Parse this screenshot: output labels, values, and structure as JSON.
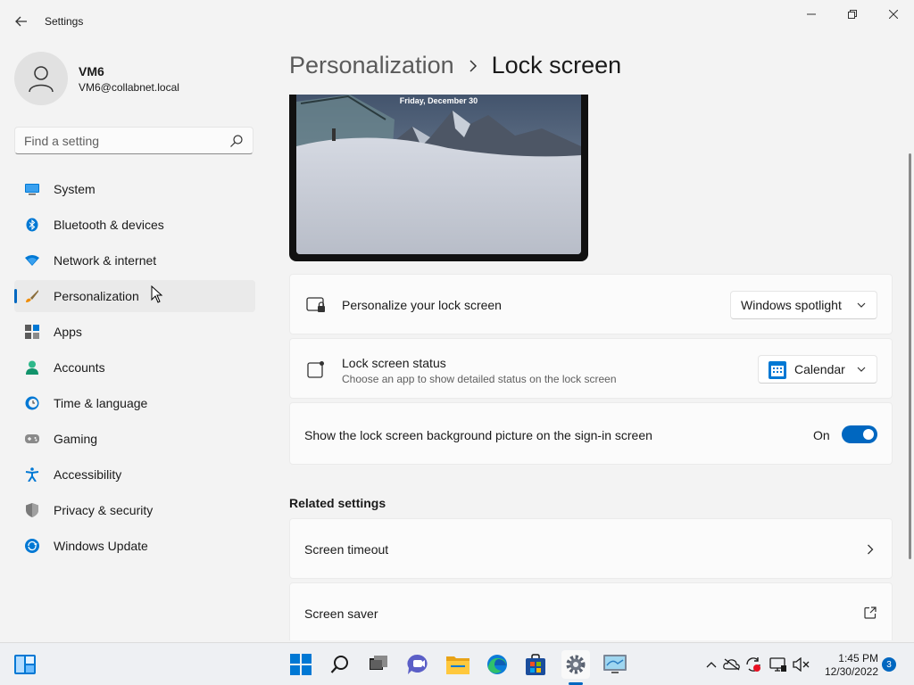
{
  "window": {
    "title": "Settings",
    "back_icon": "arrow-left-icon",
    "controls": [
      "minimize-icon",
      "restore-icon",
      "close-icon"
    ]
  },
  "profile": {
    "name": "VM6",
    "email": "VM6@collabnet.local",
    "avatar_icon": "person-icon"
  },
  "search": {
    "placeholder": "Find a setting",
    "icon": "search-icon"
  },
  "nav": {
    "items": [
      {
        "label": "System",
        "icon": "monitor-icon",
        "active": false
      },
      {
        "label": "Bluetooth & devices",
        "icon": "bluetooth-icon",
        "active": false
      },
      {
        "label": "Network & internet",
        "icon": "wifi-icon",
        "active": false
      },
      {
        "label": "Personalization",
        "icon": "brush-icon",
        "active": true
      },
      {
        "label": "Apps",
        "icon": "apps-icon",
        "active": false
      },
      {
        "label": "Accounts",
        "icon": "accounts-icon",
        "active": false
      },
      {
        "label": "Time & language",
        "icon": "clock-globe-icon",
        "active": false
      },
      {
        "label": "Gaming",
        "icon": "gamepad-icon",
        "active": false
      },
      {
        "label": "Accessibility",
        "icon": "accessibility-icon",
        "active": false
      },
      {
        "label": "Privacy & security",
        "icon": "shield-icon",
        "active": false
      },
      {
        "label": "Windows Update",
        "icon": "update-icon",
        "active": false
      }
    ]
  },
  "breadcrumb": {
    "parent": "Personalization",
    "current": "Lock screen"
  },
  "preview": {
    "date_text": "Friday, December 30"
  },
  "settings": {
    "personalize": {
      "title": "Personalize your lock screen",
      "value": "Windows spotlight",
      "icon": "lock-screen-icon"
    },
    "status": {
      "title": "Lock screen status",
      "subtitle": "Choose an app to show detailed status on the lock screen",
      "value": "Calendar",
      "icon": "status-square-icon",
      "app_icon": "calendar-app-icon"
    },
    "signin_background": {
      "title": "Show the lock screen background picture on the sign-in screen",
      "state_label": "On",
      "enabled": true
    }
  },
  "related": {
    "header": "Related settings",
    "items": [
      {
        "label": "Screen timeout",
        "icon": "chevron-right-icon"
      },
      {
        "label": "Screen saver",
        "icon": "open-external-icon"
      }
    ]
  },
  "taskbar": {
    "apps": [
      "start-icon",
      "search-icon",
      "task-view-icon",
      "teams-chat-icon",
      "file-explorer-icon",
      "edge-icon",
      "store-icon",
      "settings-icon",
      "remote-desktop-icon"
    ],
    "active_app": "settings-icon",
    "tray": [
      "chevron-up-icon",
      "onedrive-offline-icon",
      "sync-error-icon",
      "display-icon",
      "volume-muted-icon"
    ],
    "time": "1:45 PM",
    "date": "12/30/2022",
    "notification_count": "3"
  },
  "colors": {
    "accent": "#0067c0",
    "window_bg": "#f3f3f3",
    "card_bg": "#fbfbfb"
  }
}
